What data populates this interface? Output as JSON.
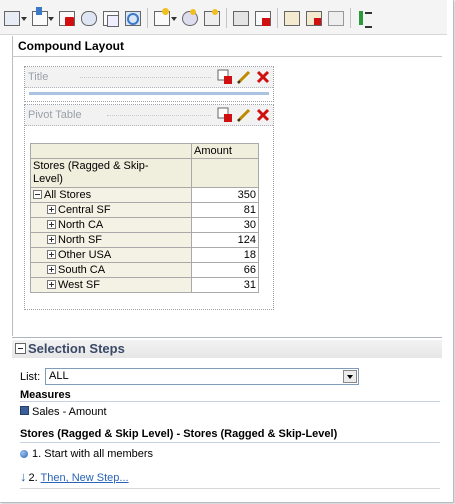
{
  "toolbar": {
    "icons": [
      "print-icon",
      "export-icon",
      "delete-view-icon",
      "preview-icon",
      "copy-icon",
      "refresh-icon",
      "new-view-icon",
      "view-properties-icon",
      "settings-icon",
      "calculator-icon",
      "format-icon",
      "compound-layout-icon",
      "edit-view-icon",
      "remove-icon",
      "sort-icon"
    ]
  },
  "layout": {
    "title": "Compound Layout"
  },
  "views": [
    {
      "name": "Title"
    },
    {
      "name": "Pivot Table"
    }
  ],
  "pivot": {
    "column_header": "Amount",
    "row_header": [
      "Stores (Ragged & Skip-",
      "Level)"
    ],
    "rows": [
      {
        "label": "All Stores",
        "value": "350",
        "expanded": true
      },
      {
        "label": "Central SF",
        "value": "81",
        "expanded": false
      },
      {
        "label": "North CA",
        "value": "30",
        "expanded": false
      },
      {
        "label": "North SF",
        "value": "124",
        "expanded": false
      },
      {
        "label": "Other USA",
        "value": "18",
        "expanded": false
      },
      {
        "label": "South CA",
        "value": "66",
        "expanded": false
      },
      {
        "label": "West SF",
        "value": "31",
        "expanded": false
      }
    ]
  },
  "selection_steps": {
    "title": "Selection Steps",
    "list_label": "List:",
    "list_value": "ALL",
    "measures_label": "Measures",
    "measure_item": "Sales - Amount",
    "dimension_title": "Stores (Ragged & Skip Level) - Stores (Ragged & Skip-Level)",
    "step1": "1. Start with all members",
    "step2_prefix": "2.",
    "step2_link": "Then, New Step..."
  },
  "colors": {
    "accent": "#2a64b8",
    "header_bg": "#f0eedc",
    "delete": "#d01010"
  }
}
